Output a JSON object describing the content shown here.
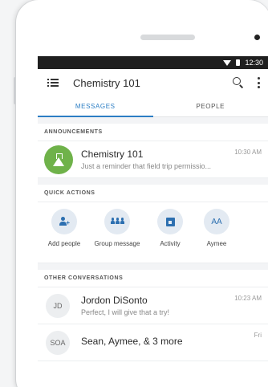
{
  "status_bar": {
    "time": "12:30"
  },
  "app_bar": {
    "title": "Chemistry 101"
  },
  "tabs": [
    {
      "label": "MESSAGES",
      "active": true
    },
    {
      "label": "PEOPLE",
      "active": false
    }
  ],
  "announcements": {
    "header": "ANNOUNCEMENTS",
    "item": {
      "name": "Chemistry 101",
      "preview": "Just a reminder that field trip permissio...",
      "time": "10:30 AM",
      "avatar_icon": "flask-icon",
      "avatar_color": "#6fb24a"
    }
  },
  "quick_actions": {
    "header": "QUICK ACTIONS",
    "items": [
      {
        "label": "Add people",
        "icon": "add-person-icon"
      },
      {
        "label": "Group message",
        "icon": "group-icon"
      },
      {
        "label": "Activity",
        "icon": "calendar-icon"
      },
      {
        "label": "Aymee",
        "initials": "AA"
      }
    ]
  },
  "other_conversations": {
    "header": "OTHER CONVERSATIONS",
    "items": [
      {
        "initials": "JD",
        "name": "Jordon DiSonto",
        "preview": "Perfect, I will give that a try!",
        "time": "10:23 AM"
      },
      {
        "initials": "SOA",
        "name": "Sean, Aymee, & 3 more",
        "preview": "",
        "time": "Fri"
      }
    ]
  },
  "colors": {
    "accent": "#2c7ec4",
    "action_bg": "#e3eaf2",
    "status_bar": "#1f1f1f"
  }
}
